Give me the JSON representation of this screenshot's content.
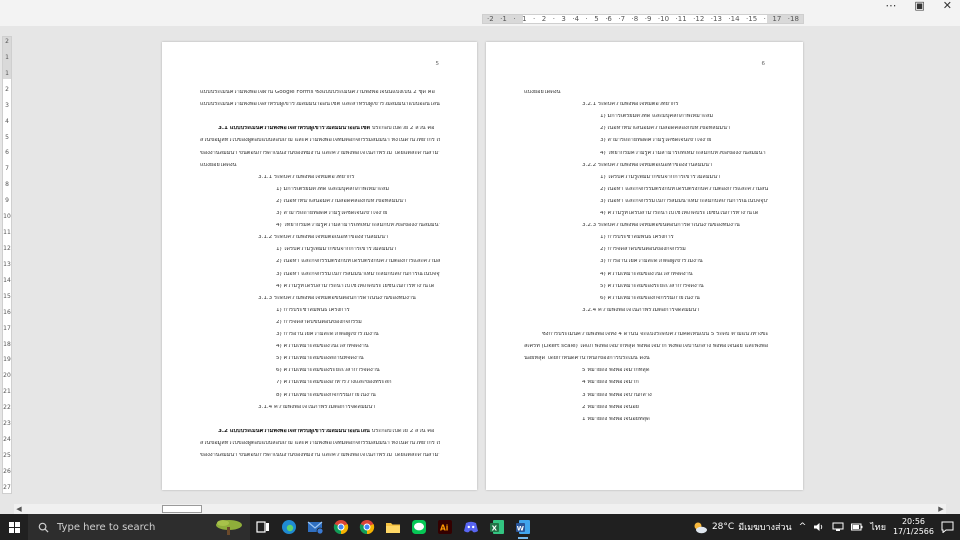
{
  "window": {
    "more_icon": "⋯",
    "restore_icon": "▣",
    "close_icon": "✕"
  },
  "ruler": {
    "h_ticks": [
      "·2",
      "·1",
      "·",
      "1",
      "·",
      "2",
      "·",
      "3",
      "·4",
      "·",
      "5",
      "·6",
      "·7",
      "·8",
      "·9",
      "·10",
      "·11",
      "·12",
      "·13",
      "·14",
      "·15",
      "·",
      "17",
      "·18"
    ],
    "v_ticks": [
      "2",
      "1",
      "1",
      "2",
      "3",
      "4",
      "5",
      "6",
      "7",
      "8",
      "9",
      "10",
      "11",
      "12",
      "13",
      "14",
      "15",
      "16",
      "17",
      "18",
      "19",
      "20",
      "21",
      "22",
      "23",
      "24",
      "25",
      "26",
      "27"
    ]
  },
  "page_left": {
    "number": "5",
    "lines": [
      {
        "text": "แบบประเมินความพึงพอใจผ่าน Google Forms ซึ่งแบบประเมินความพึงพอใจนั้นแบ่งเป็น 2 ชุด คือ",
        "cls": ""
      },
      {
        "text": "แบบประเมินความพึงพอใจสำหรับผู้เข้าร่วมสัมมนาออนไซต์ และสำหรับผู้เข้าร่วมสัมมนาแบบออนไลน์",
        "cls": ""
      },
      {
        "text": "",
        "cls": ""
      },
      {
        "bold": "3.1 แบบประเมินความพึงพอใจสำหรับผู้เข้าร่วมสัมมนาออนไซต์",
        "text": " ประกอบไปด้วย 2 ส่วน คือ",
        "cls": "ip"
      },
      {
        "text": "ส่วนข้อมูลทั่วไปของผู้ตอบแบบสอบถาม และความพึงพอใจที่มีต่อกิจกรรมสัมมนา ทั้งในด้านวิทยากร เนื้อหา",
        "cls": ""
      },
      {
        "text": "ของงานสัมมนา ขั้นตอนการดำเนินงานของทีมงาน และความพึงพอใจในภาพรวม โดยแต่ละด้านสามารถ",
        "cls": ""
      },
      {
        "text": "แบ่งย่อยได้ดังนี้",
        "cls": ""
      },
      {
        "text": "3.1.1 ระดับความพึงพอใจที่มีต่อวิทยากร",
        "cls": "i1"
      },
      {
        "text": "1) มีการเตรียมตัวที่ดี และมีบุคลิกภาพเหมาะสม",
        "cls": "i2"
      },
      {
        "text": "2) เนื้อหาที่นำเสนอมีความสอดคล้องกับหัวข้อที่สัมมนา",
        "cls": "i2"
      },
      {
        "text": "3) สามารถถ่ายทอดความรู้ได้ชัดเจนเข้าใจง่าย",
        "cls": "i2"
      },
      {
        "text": "4) วิทยากรมีความรู้ความสามารถที่เหมาะสมกับหัวข้อของงานสัมมนา",
        "cls": "i2"
      },
      {
        "text": "3.1.2 ระดับความพึงพอใจที่มีต่อเนื้อหาของงานสัมมนา",
        "cls": "i1"
      },
      {
        "text": "1) ได้รับความรู้เพิ่มมากขึ้นจากการเข้าร่วมสัมมนา",
        "cls": "i2"
      },
      {
        "text": "2) เนื้อหา และกิจกรรมตรงกับที่ได้รับตรงกับความต้องการและความสนใจ",
        "cls": "i2"
      },
      {
        "text": "3) เนื้อหา และกิจกรรมในการสัมมนาเหมาะสมกับสถานการณ์ในปัจจุบัน",
        "cls": "i2"
      },
      {
        "text": "4) ความรู้ที่ได้รับสามารถนำไปใช้ให้เกิดประโยชน์ในการทำงานได้",
        "cls": "i2"
      },
      {
        "text": "3.1.3 ระดับความพึงพอใจที่มีต่อขั้นตอนการดำเนินงานของทีมงาน",
        "cls": "i1"
      },
      {
        "text": "1) การประชาสัมพันธ์โครงการ",
        "cls": "i2"
      },
      {
        "text": "2) การจัดลำดับขั้นตอนของกิจกรรม",
        "cls": "i2"
      },
      {
        "text": "3) การอำนวยความสะดวกต่อผู้เข้าร่วมงาน",
        "cls": "i2"
      },
      {
        "text": "4) ความเหมาะสมของวันเวลาที่จัดงาน",
        "cls": "i2"
      },
      {
        "text": "5) ความเหมาะสมของสถานที่จัดงาน",
        "cls": "i2"
      },
      {
        "text": "6) ความเหมาะสมของระยะเวลาการจัดงาน",
        "cls": "i2"
      },
      {
        "text": "7) ความเหมาะสมของอาหารว่างและของที่ระลึก",
        "cls": "i2"
      },
      {
        "text": "8) ความเหมาะสมของกิจกรรมภายในงาน",
        "cls": "i2"
      },
      {
        "text": "3.1.4 ความพึงพอใจในภาพรวมต่อการจัดสัมมนา",
        "cls": "i1"
      },
      {
        "text": "",
        "cls": ""
      },
      {
        "bold": "3.2 แบบประเมินความพึงพอใจสำหรับผู้เข้าร่วมสัมมนาออนไลน์",
        "text": " ประกอบไปด้วย 2 ส่วน คือ",
        "cls": "ip"
      },
      {
        "text": "ส่วนข้อมูลทั่วไปของผู้ตอบแบบสอบถาม และความพึงพอใจที่มีต่อกิจกรรมสัมมนา ทั้งในด้านวิทยากร เนื้อหา",
        "cls": ""
      },
      {
        "text": "ของงานสัมมนา ขั้นตอนการดำเนินงานของทีมงาน และความพึงพอใจในภาพรวม โดยแต่ละด้านสามารถ",
        "cls": ""
      }
    ]
  },
  "page_right": {
    "number": "6",
    "lines": [
      {
        "text": "แบ่งย่อยได้ดังนี้",
        "cls": ""
      },
      {
        "text": "3.2.1 ระดับความพึงพอใจที่มีต่อวิทยากร",
        "cls": "i1"
      },
      {
        "text": "1) มีการเตรียมตัวที่ดี และมีบุคลิกภาพเหมาะสม",
        "cls": "i2"
      },
      {
        "text": "2) เนื้อหาที่นำเสนอมีความสอดคล้องกับหัวข้อที่สัมมนา",
        "cls": "i2"
      },
      {
        "text": "3) สามารถถ่ายทอดความรู้ได้ชัดเจนเข้าใจง่าย",
        "cls": "i2"
      },
      {
        "text": "4) วิทยากรมีความรู้ความสามารถที่เหมาะสมกับหัวข้อของงานสัมมนา",
        "cls": "i2"
      },
      {
        "text": "3.2.2 ระดับความพึงพอใจที่มีต่อเนื้อหาของงานสัมมนา",
        "cls": "i1"
      },
      {
        "text": "1) ได้รับความรู้เพิ่มมากขึ้นจากการเข้าร่วมสัมมนา",
        "cls": "i2"
      },
      {
        "text": "2) เนื้อหา และกิจกรรมตรงกับที่ได้รับตรงกับความต้องการและความสนใจ",
        "cls": "i2"
      },
      {
        "text": "3) เนื้อหา และกิจกรรมในการสัมมนาเหมาะสมกับสถานการณ์ในปัจจุบัน",
        "cls": "i2"
      },
      {
        "text": "4) ความรู้ที่ได้รับสามารถนำไปใช้ให้เกิดประโยชน์ในการทำงานได้",
        "cls": "i2"
      },
      {
        "text": "3.2.3 ระดับความพึงพอใจที่มีต่อขั้นตอนการดำเนินงานของทีมงาน",
        "cls": "i1"
      },
      {
        "text": "1) การประชาสัมพันธ์โครงการ",
        "cls": "i2"
      },
      {
        "text": "2) การจัดลำดับขั้นตอนของกิจกรรม",
        "cls": "i2"
      },
      {
        "text": "3) การอำนวยความสะดวกต่อผู้เข้าร่วมงาน",
        "cls": "i2"
      },
      {
        "text": "4) ความเหมาะสมของวันเวลาที่จัดงาน",
        "cls": "i2"
      },
      {
        "text": "5) ความเหมาะสมของระยะเวลาการจัดงาน",
        "cls": "i2"
      },
      {
        "text": "6) ความเหมาะสมของกิจกรรมภายในงาน",
        "cls": "i2"
      },
      {
        "text": "3.2.4 ความพึงพอใจในภาพรวมต่อการจัดสัมมนา",
        "cls": "i1"
      },
      {
        "text": "",
        "cls": ""
      },
      {
        "text": "ซึ่งการประเมินความพึงพอใจทั้ง 4 ด้านนี้ จะแบ่งระดับความคิดเห็นเป็น 5 ระดับ ตามแนวทางของ",
        "cls": "ip"
      },
      {
        "text": "ลิเคิร์ท (Likert scale) ได้แก่ พึงพอใจมากที่สุด พึงพอใจมาก พึงพอใจปานกลาง พึงพอใจน้อย และพึงพอใจ",
        "cls": ""
      },
      {
        "text": "น้อยที่สุด โดยกำหนดค่าน้ำหนักของการประเมิน ดังนี้",
        "cls": ""
      },
      {
        "text": "5 หมายถึง  พึงพอใจมากที่สุด",
        "cls": "i1"
      },
      {
        "text": "4 หมายถึง  พึงพอใจมาก",
        "cls": "i1"
      },
      {
        "text": "3 หมายถึง  พึงพอใจปานกลาง",
        "cls": "i1"
      },
      {
        "text": "2 หมายถึง  พึงพอใจน้อย",
        "cls": "i1"
      },
      {
        "text": "1 หมายถึง  พึงพอใจน้อยที่สุด",
        "cls": "i1"
      }
    ]
  },
  "taskbar": {
    "search_placeholder": "Type here to search",
    "weather_temp": "28°C",
    "weather_desc": "มีเมฆบางส่วน",
    "language": "ไทย",
    "time": "20:56",
    "date": "17/1/2566",
    "apps": [
      "task-view",
      "edge",
      "mail",
      "chrome",
      "chrome-alt",
      "file-explorer",
      "line",
      "illustrator",
      "discord",
      "excel",
      "word"
    ]
  },
  "colors": {
    "taskbar_bg": "#202020",
    "word_blue": "#2b579a",
    "excel_green": "#217346",
    "line_green": "#06c755",
    "discord": "#5865f2",
    "illustrator": "#ff9a00"
  }
}
